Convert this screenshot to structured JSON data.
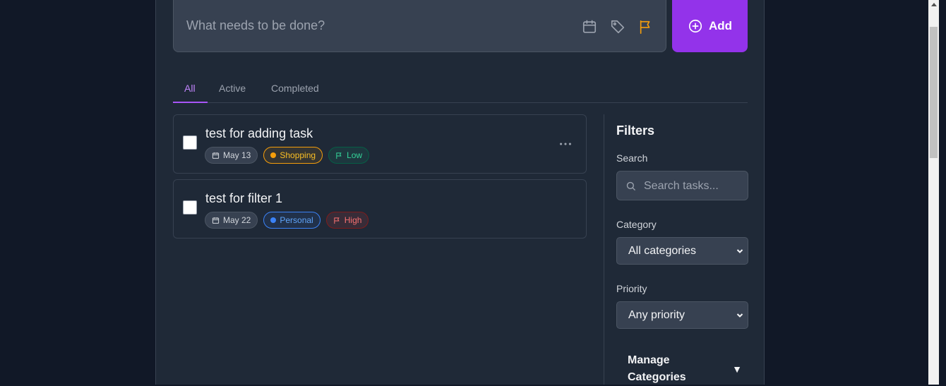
{
  "new_task": {
    "placeholder": "What needs to be done?",
    "icons": [
      "calendar-icon",
      "tag-icon",
      "flag-icon"
    ],
    "flag_color": "#f59e0b",
    "add_label": "Add",
    "add_color": "#9333ea"
  },
  "tabs": [
    {
      "label": "All",
      "active": true
    },
    {
      "label": "Active",
      "active": false
    },
    {
      "label": "Completed",
      "active": false
    }
  ],
  "tasks": [
    {
      "title": "test for adding task",
      "date": "May 13",
      "category": "Shopping",
      "category_color": "#f59e0b",
      "priority": "Low",
      "priority_color": "#34d399"
    },
    {
      "title": "test for filter 1",
      "date": "May 22",
      "category": "Personal",
      "category_color": "#3b82f6",
      "priority": "High",
      "priority_color": "#f87171"
    }
  ],
  "filters": {
    "title": "Filters",
    "search_label": "Search",
    "search_placeholder": "Search tasks...",
    "category_label": "Category",
    "category_value": "All categories",
    "priority_label": "Priority",
    "priority_value": "Any priority",
    "manage_label": "Manage Categories",
    "manage_arrow": "▼"
  }
}
